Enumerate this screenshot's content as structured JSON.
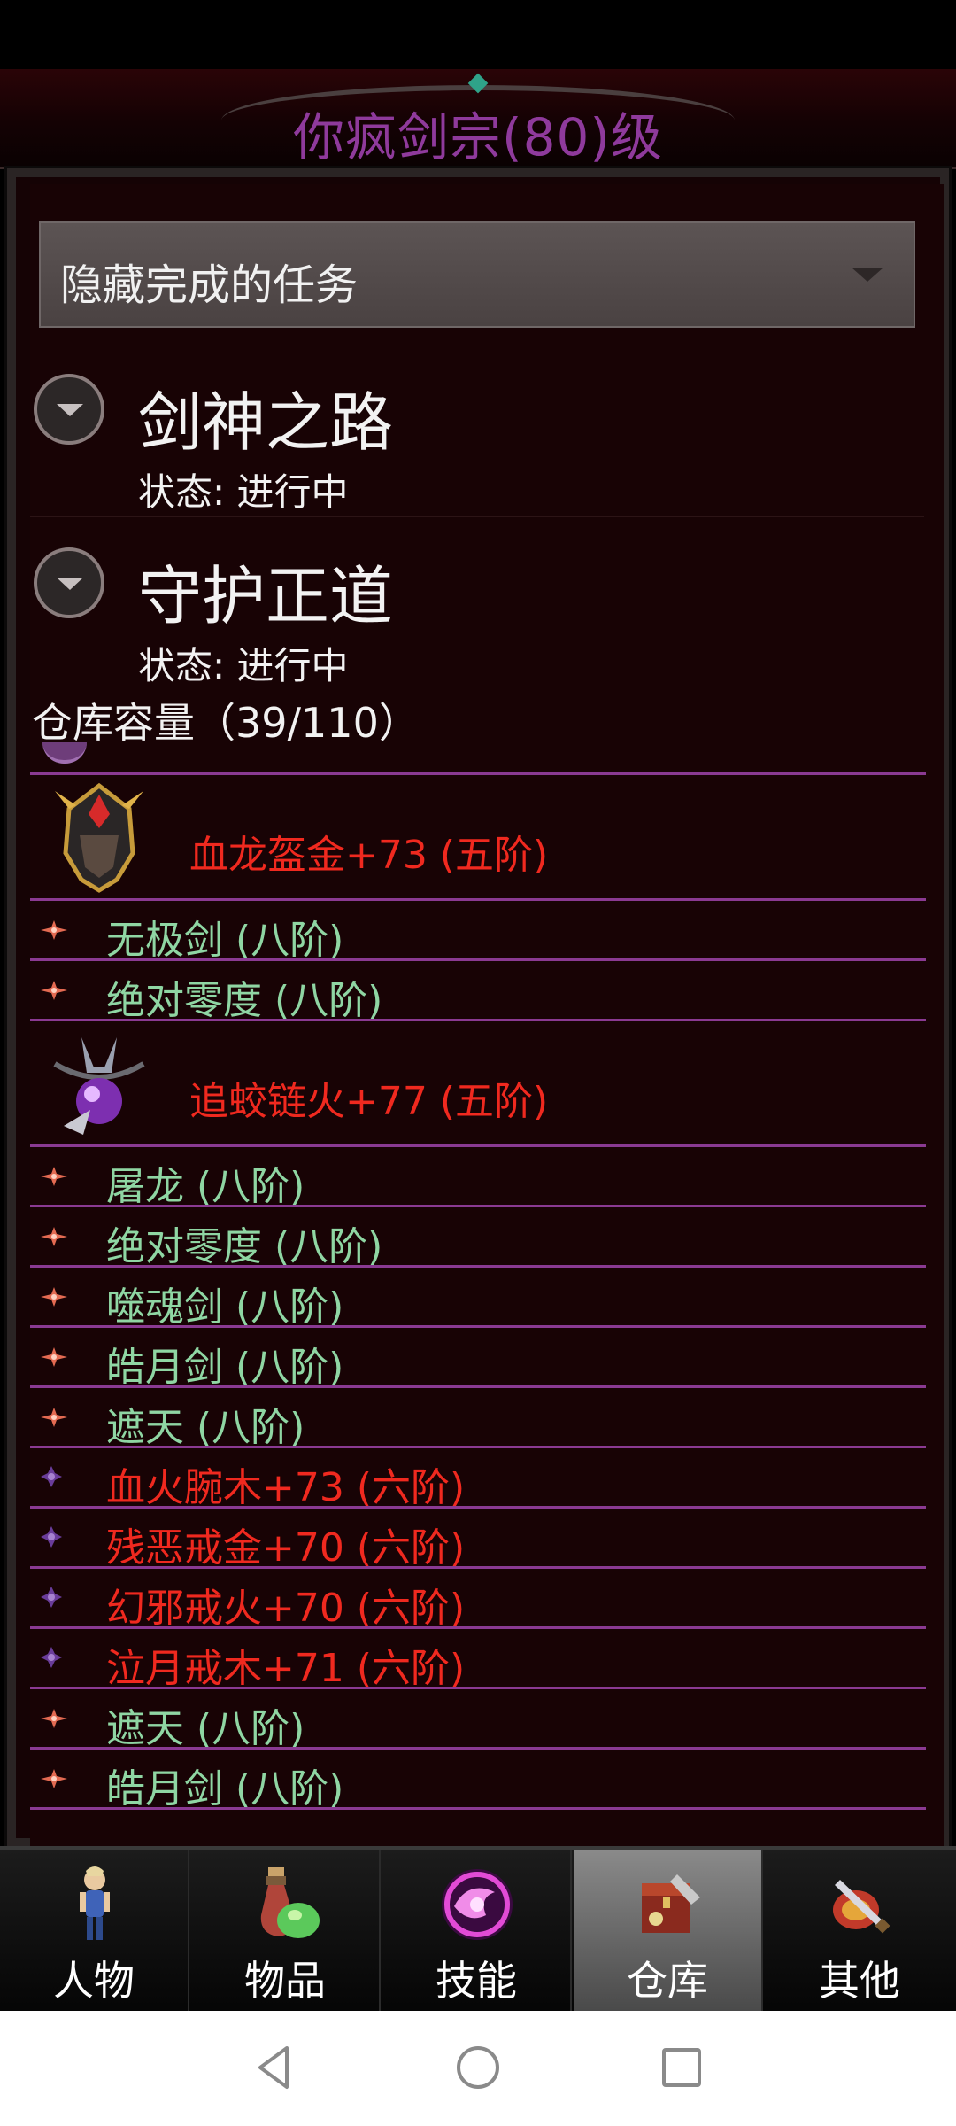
{
  "title": "你疯剑宗(80)级",
  "filter": {
    "label": "隐藏完成的任务"
  },
  "quests": [
    {
      "name": "剑神之路",
      "status": "状态: 进行中"
    },
    {
      "name": "守护正道",
      "status": "状态: 进行中"
    }
  ],
  "warehouse": {
    "capacity_label": "仓库容量（39/110）",
    "items": [
      {
        "name": "血龙盔金+73 (五阶)",
        "color": "#f0291f",
        "icon": "helmet-icon",
        "size": "big"
      },
      {
        "name": "无极剑 (八阶)",
        "color": "#8fd6a3",
        "icon": "spark-icon",
        "size": "small"
      },
      {
        "name": "绝对零度 (八阶)",
        "color": "#8fd6a3",
        "icon": "spark-icon",
        "size": "small"
      },
      {
        "name": "追蛟链火+77 (五阶)",
        "color": "#f0291f",
        "icon": "amulet-icon",
        "size": "big"
      },
      {
        "name": "屠龙 (八阶)",
        "color": "#8fd6a3",
        "icon": "spark-icon",
        "size": "small"
      },
      {
        "name": "绝对零度 (八阶)",
        "color": "#8fd6a3",
        "icon": "spark-icon",
        "size": "small"
      },
      {
        "name": "噬魂剑 (八阶)",
        "color": "#8fd6a3",
        "icon": "spark-icon",
        "size": "small"
      },
      {
        "name": "皓月剑 (八阶)",
        "color": "#8fd6a3",
        "icon": "spark-icon",
        "size": "small"
      },
      {
        "name": "遮天 (八阶)",
        "color": "#8fd6a3",
        "icon": "spark-icon",
        "size": "small"
      },
      {
        "name": "血火腕木+73 (六阶)",
        "color": "#f0291f",
        "icon": "purple-gem-icon",
        "size": "small"
      },
      {
        "name": "残恶戒金+70 (六阶)",
        "color": "#f0291f",
        "icon": "purple-gem-icon",
        "size": "small"
      },
      {
        "name": "幻邪戒火+70 (六阶)",
        "color": "#f0291f",
        "icon": "purple-gem-icon",
        "size": "small"
      },
      {
        "name": "泣月戒木+71 (六阶)",
        "color": "#f0291f",
        "icon": "purple-gem-icon",
        "size": "small"
      },
      {
        "name": "遮天 (八阶)",
        "color": "#8fd6a3",
        "icon": "spark-icon",
        "size": "small"
      },
      {
        "name": "皓月剑 (八阶)",
        "color": "#8fd6a3",
        "icon": "spark-icon",
        "size": "small"
      }
    ]
  },
  "tabs": [
    {
      "label": "人物",
      "icon": "character-icon",
      "active": false
    },
    {
      "label": "物品",
      "icon": "potion-icon",
      "active": false
    },
    {
      "label": "技能",
      "icon": "skill-orb-icon",
      "active": false
    },
    {
      "label": "仓库",
      "icon": "chest-icon",
      "active": true
    },
    {
      "label": "其他",
      "icon": "sword-shield-icon",
      "active": false
    }
  ],
  "colors": {
    "title": "#8f3a9c",
    "high_tier": "#f0291f",
    "normal_tier": "#8fd6a3",
    "separator": "#8a3a92"
  },
  "system_nav": [
    "back-icon",
    "home-icon",
    "recents-icon"
  ]
}
